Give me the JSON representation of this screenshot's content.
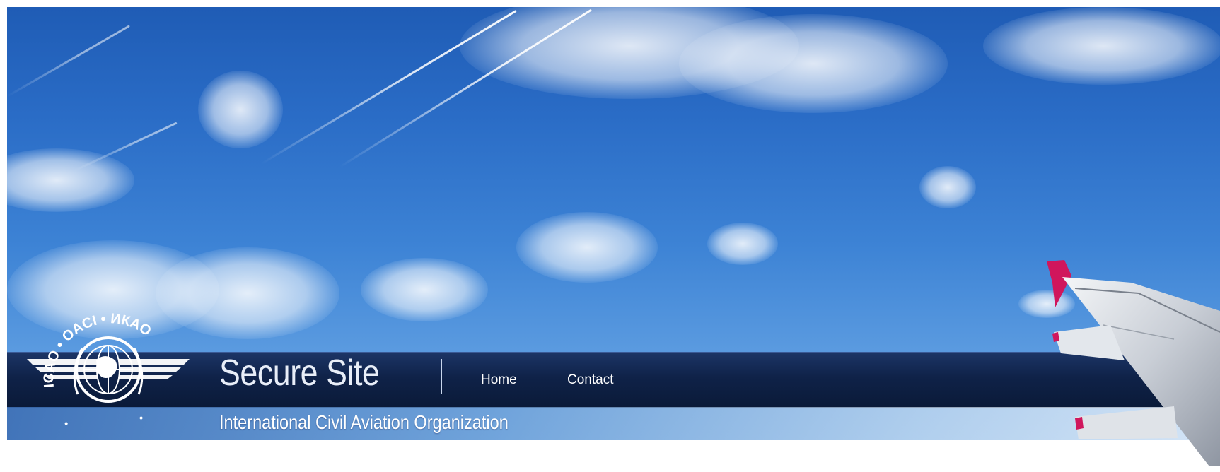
{
  "header": {
    "site_title": "Secure Site",
    "organization": "International Civil Aviation Organization",
    "logo": {
      "icon": "icao-emblem-icon",
      "ring_text": "ICAO • OACI • ИКАО"
    }
  },
  "nav": {
    "items": [
      {
        "label": "Home"
      },
      {
        "label": "Contact"
      }
    ]
  },
  "colors": {
    "sky_top": "#1f5cb5",
    "sky_bottom": "#79b0e8",
    "navbar": "#0f2248",
    "wing_tip": "#d0165c",
    "text": "#ffffff"
  }
}
